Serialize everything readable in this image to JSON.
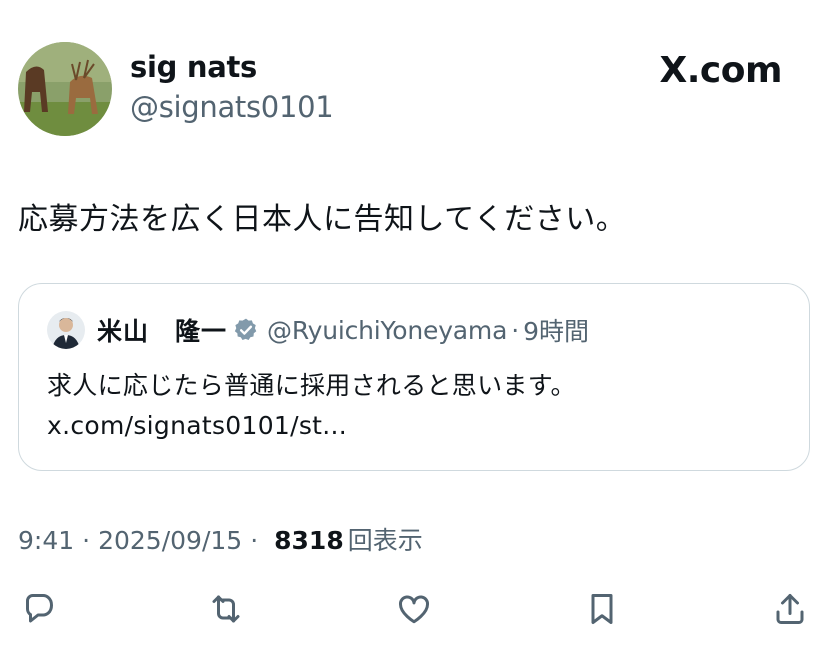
{
  "author": {
    "display_name": "sig nats",
    "handle": "@signats0101"
  },
  "brand": {
    "label": "X.com"
  },
  "tweet": {
    "text": "応募方法を広く日本人に告知してください。"
  },
  "quote": {
    "display_name": "米山　隆一",
    "handle": "@RyuichiYoneyama",
    "separator": "·",
    "time": "9時間",
    "body": "求人に応じたら普通に採用されると思います。 x.com/signats0101/st..."
  },
  "meta": {
    "time": "9:41",
    "separator": "·",
    "date": "2025/09/15",
    "views_count": "8318",
    "views_label": "回表示"
  },
  "icons": {
    "reply": "reply-icon",
    "retweet": "retweet-icon",
    "like": "heart-icon",
    "bookmark": "bookmark-icon",
    "share": "share-icon",
    "verified": "verified-badge-icon"
  },
  "colors": {
    "text": "#0f1419",
    "secondary": "#536471",
    "border": "#cfd9de",
    "verified": "#829aab"
  }
}
